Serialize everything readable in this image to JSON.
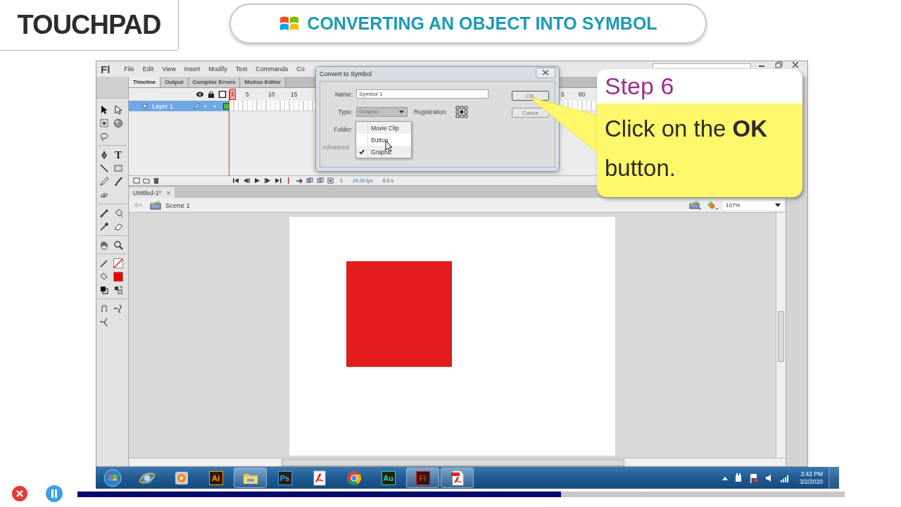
{
  "header": {
    "logo": "TOUCHPAD",
    "banner": "CONVERTING AN OBJECT INTO SYMBOL"
  },
  "app": {
    "logo": "Fl",
    "menu": [
      "File",
      "Edit",
      "View",
      "Insert",
      "Modify",
      "Text",
      "Commands",
      "Co"
    ],
    "panel_tabs": [
      {
        "label": "Timeline",
        "selected": true
      },
      {
        "label": "Output",
        "selected": false
      },
      {
        "label": "Compiler Errors",
        "selected": false
      },
      {
        "label": "Motion Editor",
        "selected": false
      }
    ],
    "toolbox": {
      "text_tool": "T"
    },
    "timeline": {
      "current_frame": "1",
      "ruler": [
        "5",
        "10",
        "15"
      ],
      "ruler_far": [
        "5",
        "80"
      ],
      "layers": [
        {
          "name": "Layer 1",
          "selected": true
        }
      ],
      "status": [
        "1",
        "24.00 fps",
        "0.0 s"
      ]
    },
    "document_tab": {
      "title": "Untitled-1*",
      "close": "×"
    },
    "scene": "Scene 1",
    "zoom": "107%"
  },
  "dialog": {
    "title": "Convert to Symbol",
    "name_label": "Name:",
    "name_value": "Symbol 1",
    "type_label": "Type:",
    "type_value": "Graphic",
    "registration_label": "Registration:",
    "folder_label": "Folder:",
    "advanced_label": "Advanced",
    "ok": "OK",
    "cancel": "Cance",
    "type_options": [
      {
        "label": "Movie Clip",
        "selected": false,
        "checked": false
      },
      {
        "label": "Button",
        "selected": true,
        "checked": false
      },
      {
        "label": "Graphic",
        "selected": false,
        "checked": true
      }
    ]
  },
  "callout": {
    "title": "Step 6",
    "text": "Click on the **OK** button."
  },
  "taskbar": {
    "apps": [
      {
        "kind": "start",
        "active": false
      },
      {
        "kind": "browser",
        "active": false
      },
      {
        "kind": "player",
        "active": false
      },
      {
        "kind": "tile",
        "label": "Ai",
        "color": "#ff9a00",
        "active": false
      },
      {
        "kind": "folder",
        "active": true
      },
      {
        "kind": "tile",
        "label": "Ps",
        "color": "#31a8ff",
        "active": false
      },
      {
        "kind": "reader",
        "active": false
      },
      {
        "kind": "chrome",
        "active": false
      },
      {
        "kind": "tile",
        "label": "Au",
        "color": "#00e4bb",
        "active": false
      },
      {
        "kind": "tile",
        "label": "Fl",
        "color": "#e8271d",
        "active": true
      },
      {
        "kind": "pdf",
        "active": true
      }
    ],
    "time": "3:42 PM",
    "date": "3/2/2020"
  },
  "player": {
    "level": 0.63
  }
}
